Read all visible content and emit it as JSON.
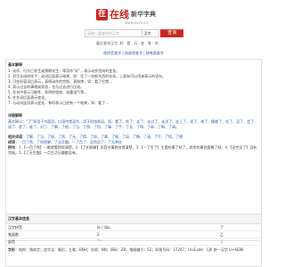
{
  "logo": {
    "mark": "在",
    "name": "在线",
    "sub": "新华字典",
    "url": "www.xxxx.cn"
  },
  "search": {
    "placeholder": "请输入要查找的汉字",
    "select": "汉字",
    "button": "查询"
  },
  "hot": "最近查询汉字: 柏 · 看 · 玩 · 查 · 笔 · 划",
  "nav": "按拼音查字 | 按部首查字 | 按笔画查字",
  "basic": {
    "title": "基本解释",
    "items": [
      "1. 动作、行为已发生或预期发生，常用作“好”，表示动作完成的变化。",
      "2. 初生长成的样子；动词后面表示结果，如：生了一些新东西的花朵，上面有可以用来表示的语句。",
      "3. 可在形容词后表示，表明动作的完结，表结束，如：看了它就…",
      "4. 表示过去的事物或状态，也与过去进行比较。",
      "5. 在句中表示可能性、表明的程度、加重语气等。",
      "6. 在名词后面表示变化。",
      "7. 与动词连用表示变化，有时表示已经有一个结果，如：看了…"
    ]
  },
  "detail": {
    "title": "详细解释",
    "content": "基本释义：“了”多用于书面语，口语中常读作…用于时态助词。如：看了、吃了、走了、走过了、走进了、走上了、说了、来了、睡着了、在了、没了、会了、成了、是了、谁了、对了、了解、了结、了当、了然、了悟、了事、了手、了无、了得、了却、了断、了清。"
  },
  "related": {
    "label": "相关词语",
    "content": "了解、了当、了结、了然、了无、了得、了却、了事、了账、了局、了断、了清、了手、了悟、了望"
  },
  "idiom": {
    "label": "成语",
    "content": "一目了然、了如指掌、了无生趣、一了百了、没完没了、了无牵挂"
  },
  "example": {
    "label": "例句",
    "content": "1.【一目了然】一眼就看得很清楚。2.【了如指掌】形容对事物非常清楚。3.【一了百了】主要的事了结了，其余的事也跟着了结。4.【没完没了】没有完结。5.【了无生趣】一点生活乐趣都没有。"
  },
  "table": {
    "title": "汉字基本信息",
    "rows": [
      [
        "汉字拼音",
        "le / liǎo",
        "了"
      ],
      [
        "笔画数",
        "2",
        "乙"
      ],
      [
        "部首",
        "乛",
        "亅"
      ]
    ]
  },
  "footer": {
    "label": "字形",
    "content": "结构：独体字；造字法：象形；五笔：BNH；仓颉：NN；郑码：ZB；笔顺编号：52；四角号码：17207；UniCode：CJK 统一汉字 U+4E86"
  }
}
